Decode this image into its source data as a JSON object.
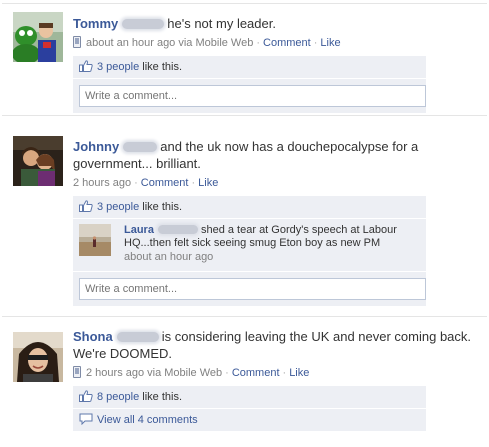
{
  "posts": [
    {
      "author": "Tommy",
      "text": "he's not my leader.",
      "time": "about an hour ago via Mobile Web",
      "comment_label": "Comment",
      "like_label": "Like",
      "likes": {
        "link": "3 people",
        "suffix": " like this."
      },
      "write_placeholder": "Write a comment..."
    },
    {
      "author": "Johnny",
      "text": "and the uk now has a douchepocalypse for a government... brilliant.",
      "time": "2 hours ago",
      "comment_label": "Comment",
      "like_label": "Like",
      "likes": {
        "link": "3 people",
        "suffix": " like this."
      },
      "comment": {
        "author": "Laura",
        "text": "shed a tear at Gordy's speech at Labour HQ...then felt sick seeing smug Eton boy as new PM",
        "time": "about an hour ago"
      },
      "write_placeholder": "Write a comment..."
    },
    {
      "author": "Shona",
      "text": "is considering leaving the UK and never coming back. We're DOOMED.",
      "time": "2 hours ago via Mobile Web",
      "comment_label": "Comment",
      "like_label": "Like",
      "likes": {
        "link": "8 people",
        "suffix": " like this."
      },
      "view_all": "View all 4 comments"
    }
  ],
  "separator": "·",
  "icons": {
    "mobile": "mobile-phone-icon",
    "like": "thumbs-up-icon",
    "comments": "comment-bubble-icon"
  },
  "colors": {
    "link": "#3b5998",
    "box_bg": "#edeff4",
    "meta_gray": "#808080"
  }
}
